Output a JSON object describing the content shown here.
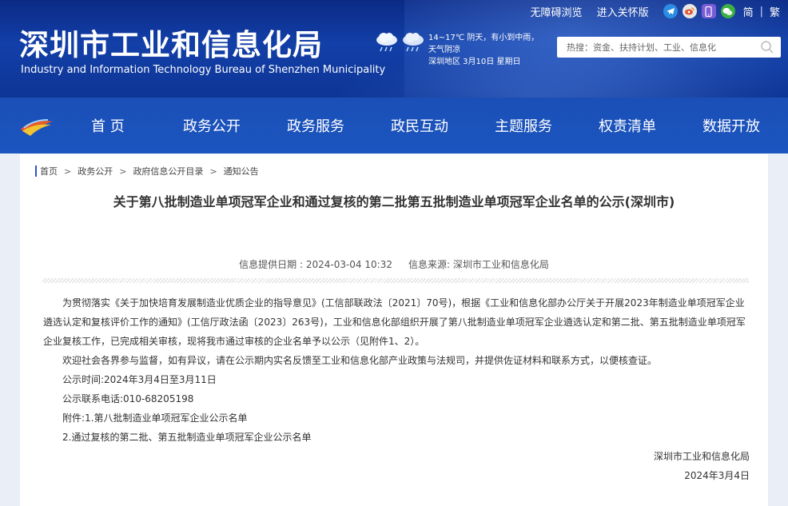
{
  "header": {
    "title": "深圳市工业和信息化局",
    "subtitle": "Industry and Information Technology Bureau of Shenzhen Municipality",
    "top_links": [
      "无障碍浏览",
      "进入关怀版"
    ],
    "social_icons": [
      "telegram-icon",
      "weibo-icon",
      "mobile-icon",
      "wechat-icon"
    ],
    "lang_simplified": "简",
    "lang_separator": "|",
    "lang_traditional": "繁",
    "weather": {
      "line1": "14~17℃  阴天，有小到中雨，",
      "line2": "天气阴凉",
      "line3": "深圳地区 3月10日   星期日"
    },
    "search_placeholder": "热搜：资金、扶持计划、工业、信息化"
  },
  "nav": {
    "items": [
      "首 页",
      "政务公开",
      "政务服务",
      "政民互动",
      "主题服务",
      "权责清单",
      "数据开放"
    ]
  },
  "breadcrumb": [
    "首页",
    "政务公开",
    "政府信息公开目录",
    "通知公告"
  ],
  "breadcrumb_separator": ">",
  "article": {
    "title": "关于第八批制造业单项冠军企业和通过复核的第二批第五批制造业单项冠军企业名单的公示(深圳市)",
    "date_label": "信息提供日期 : 2024-03-04 10:32",
    "source_label": "信息来源:   深圳市工业和信息化局",
    "paragraph1": "为贯彻落实《关于加快培育发展制造业优质企业的指导意见》(工信部联政法〔2021〕70号)，根据《工业和信息化部办公厅关于开展2023年制造业单项冠军企业遴选认定和复核评价工作的通知》(工信厅政法函〔2023〕263号)，工业和信息化部组织开展了第八批制造业单项冠军企业遴选认定和第二批、第五批制造业单项冠军企业复核工作，已完成相关审核，现将我市通过审核的企业名单予以公示（见附件1、2）。",
    "paragraph2": "欢迎社会各界参与监督，如有异议，请在公示期内实名反馈至工业和信息化部产业政策与法规司，并提供佐证材料和联系方式，以便核查证。",
    "period": "公示时间:2024年3月4日至3月11日",
    "phone": "公示联系电话:010-68205198",
    "attachment1": "附件:1.第八批制造业单项冠军企业公示名单",
    "attachment2": "2.通过复核的第二批、第五批制造业单项冠军企业公示名单",
    "signature": "深圳市工业和信息化局",
    "sign_date": "2024年3月4日"
  },
  "colors": {
    "header_bg": "#0e3596",
    "nav_bg": "#1c55c0",
    "page_bg": "#e9eef7",
    "accent": "#2a56c6"
  }
}
